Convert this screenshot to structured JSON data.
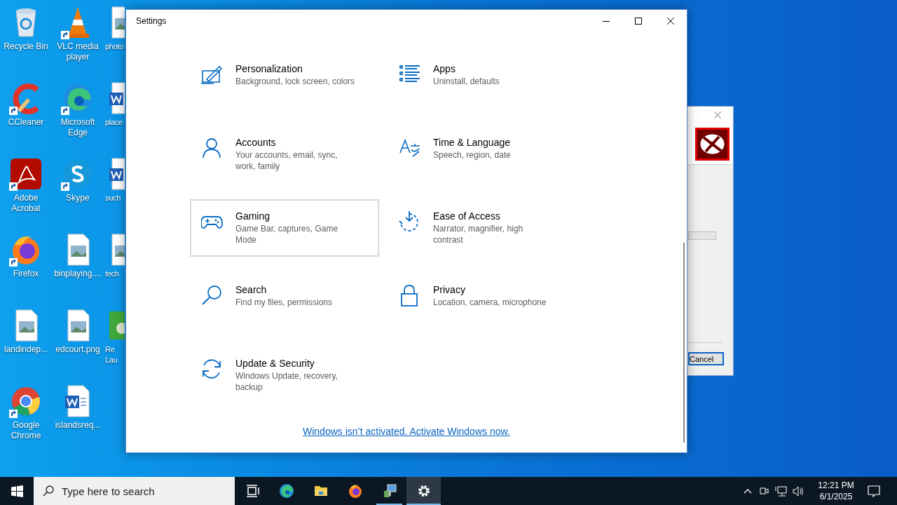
{
  "desktop_icons": [
    {
      "label": "Recycle Bin",
      "kind": "recycle",
      "shortcut": false
    },
    {
      "label": "VLC media player",
      "kind": "vlc",
      "shortcut": true
    },
    {
      "label": "CCleaner",
      "kind": "ccleaner",
      "shortcut": true
    },
    {
      "label": "Microsoft Edge",
      "kind": "edge",
      "shortcut": true
    },
    {
      "label": "Adobe Acrobat",
      "kind": "acrobat",
      "shortcut": true
    },
    {
      "label": "Skype",
      "kind": "skype",
      "shortcut": true
    },
    {
      "label": "Firefox",
      "kind": "firefox",
      "shortcut": true
    },
    {
      "label": "binplaying....",
      "kind": "image",
      "shortcut": false
    },
    {
      "label": "landindep...",
      "kind": "image",
      "shortcut": false
    },
    {
      "label": "edcourt.png",
      "kind": "image",
      "shortcut": false
    },
    {
      "label": "Google Chrome",
      "kind": "chrome",
      "shortcut": true
    },
    {
      "label": "islandsreq...",
      "kind": "word",
      "shortcut": false
    }
  ],
  "desktop_icons_partial": [
    {
      "label": "photo",
      "kind": "image"
    },
    {
      "label": "place",
      "kind": "word"
    },
    {
      "label": "such",
      "kind": "word"
    },
    {
      "label": "tech",
      "kind": "image"
    },
    {
      "label": "Re Lau",
      "kind": "program"
    }
  ],
  "settings_window": {
    "title": "Settings",
    "categories": [
      {
        "title": "Personalization",
        "subtitle": "Background, lock screen, colors",
        "kind": "personalization",
        "hovered": false
      },
      {
        "title": "Apps",
        "subtitle": "Uninstall, defaults",
        "kind": "apps",
        "hovered": false
      },
      {
        "title": "Accounts",
        "subtitle": "Your accounts, email, sync, work, family",
        "kind": "accounts",
        "hovered": false
      },
      {
        "title": "Time & Language",
        "subtitle": "Speech, region, date",
        "kind": "time",
        "hovered": false
      },
      {
        "title": "Gaming",
        "subtitle": "Game Bar, captures, Game Mode",
        "kind": "gaming",
        "hovered": true
      },
      {
        "title": "Ease of Access",
        "subtitle": "Narrator, magnifier, high contrast",
        "kind": "ease",
        "hovered": false
      },
      {
        "title": "Search",
        "subtitle": "Find my files, permissions",
        "kind": "search",
        "hovered": false
      },
      {
        "title": "Privacy",
        "subtitle": "Location, camera, microphone",
        "kind": "privacy",
        "hovered": false
      },
      {
        "title": "Update & Security",
        "subtitle": "Windows Update, recovery, backup",
        "kind": "update",
        "hovered": false
      }
    ],
    "activation_link": "Windows isn’t activated. Activate Windows now."
  },
  "background_dialog": {
    "progress": {
      "level": 0
    },
    "cancel_button": "Cancel"
  },
  "taskbar": {
    "search_placeholder": "Type here to search",
    "apps": [
      {
        "kind": "taskview",
        "selected": false
      },
      {
        "kind": "edge",
        "selected": false
      },
      {
        "kind": "explorer",
        "selected": false
      },
      {
        "kind": "firefox",
        "selected": false
      },
      {
        "kind": "installer",
        "selected": false
      },
      {
        "kind": "settings",
        "selected": true
      }
    ],
    "time": "12:21 PM",
    "date": "6/1/2025"
  }
}
